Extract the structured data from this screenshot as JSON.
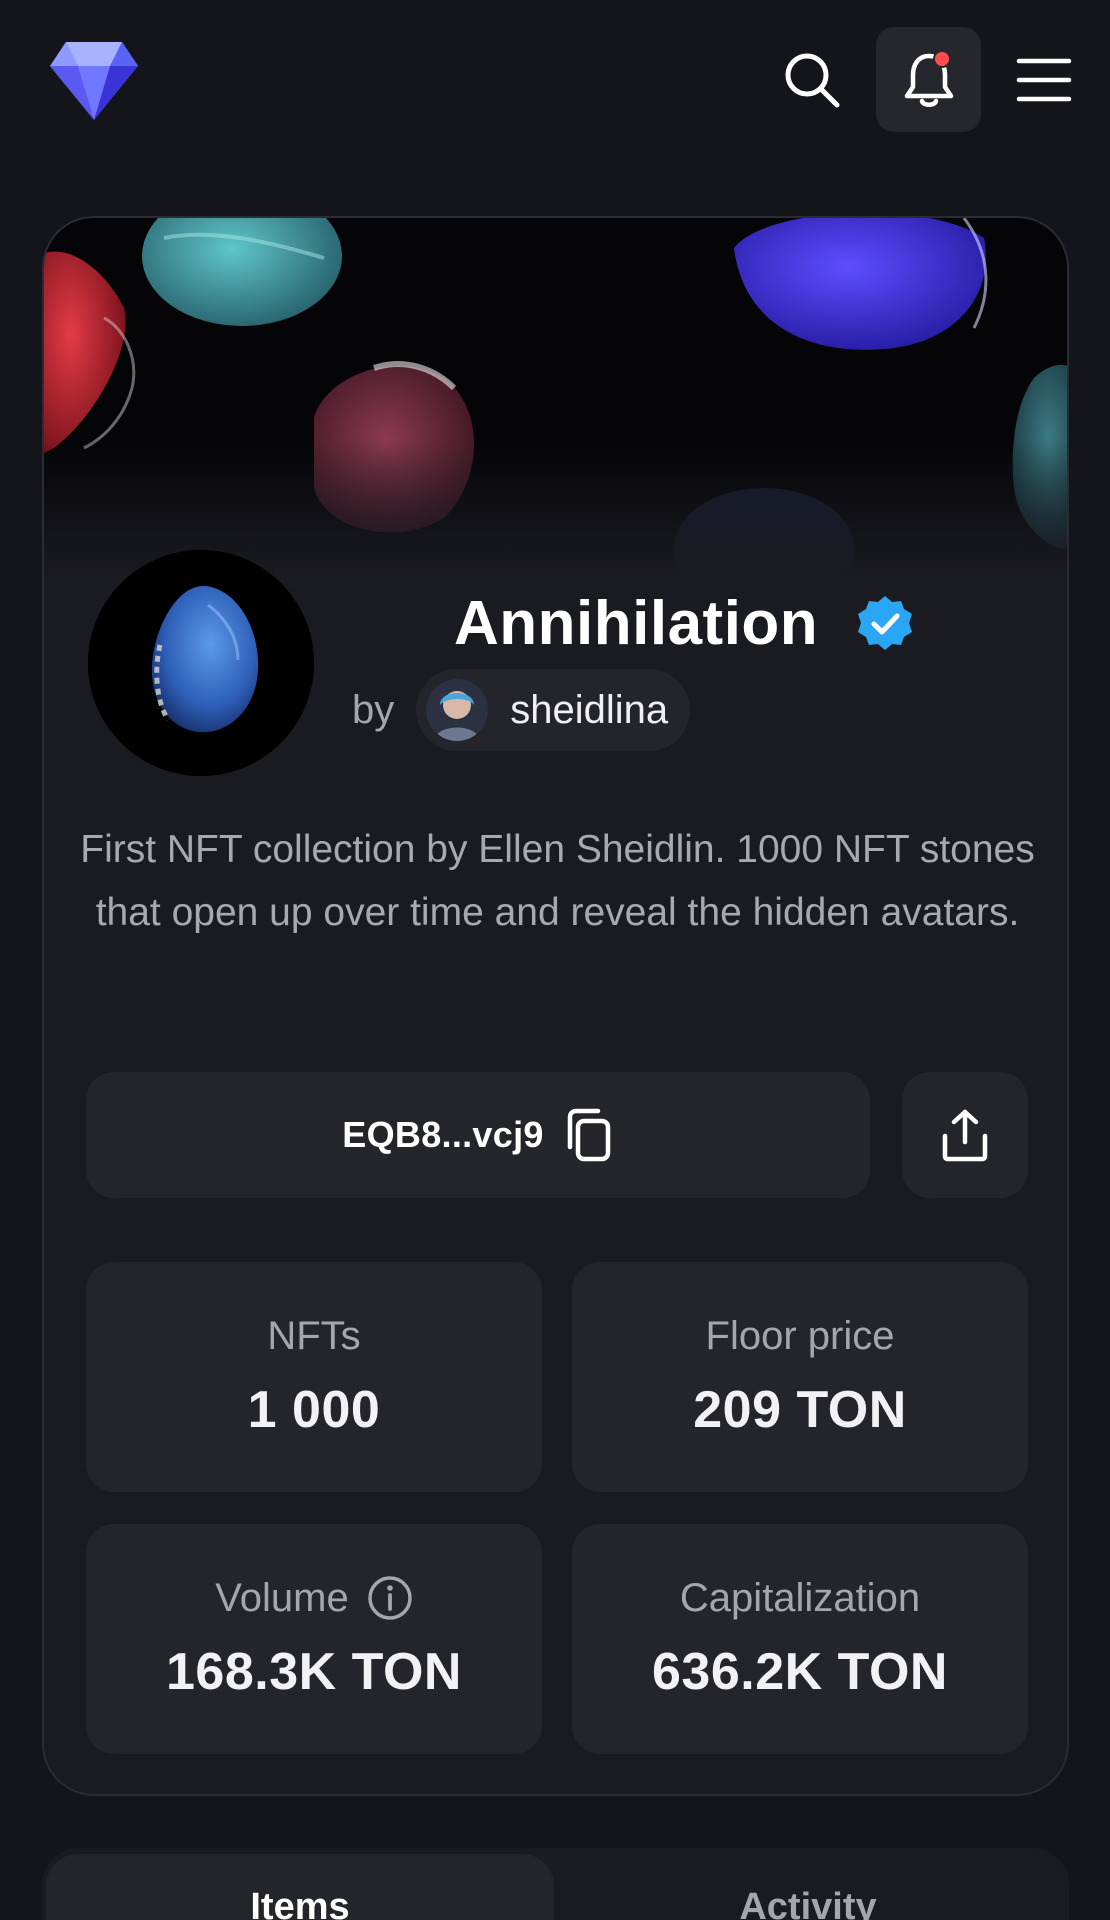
{
  "header": {
    "logo_icon": "diamond-logo-icon",
    "search_icon": "search-icon",
    "notifications_icon": "bell-icon",
    "notification_dot_color": "#ff4d4f",
    "menu_icon": "hamburger-menu-icon"
  },
  "collection": {
    "title": "Annihilation",
    "verified_color": "#2ba6f5",
    "by_label": "by",
    "creator_name": "sheidlina",
    "description": "First NFT collection by Ellen Sheidlin. 1000 NFT stones that open up over time and reveal the hidden avatars.",
    "address": "EQB8...vcj9",
    "copy_icon": "copy-icon",
    "share_icon": "share-icon"
  },
  "stats": [
    {
      "label": "NFTs",
      "value": "1 000"
    },
    {
      "label": "Floor price",
      "value": "209 TON"
    },
    {
      "label": "Volume",
      "value": "168.3K TON"
    },
    {
      "label": "Capitalization",
      "value": "636.2K TON"
    }
  ],
  "tabs": [
    {
      "label": "Items",
      "active": true
    },
    {
      "label": "Activity",
      "active": false
    }
  ],
  "colors": {
    "background": "#14151a",
    "card": "#1a1b21",
    "surface": "#24252b",
    "muted_text": "#a5a6ad"
  }
}
